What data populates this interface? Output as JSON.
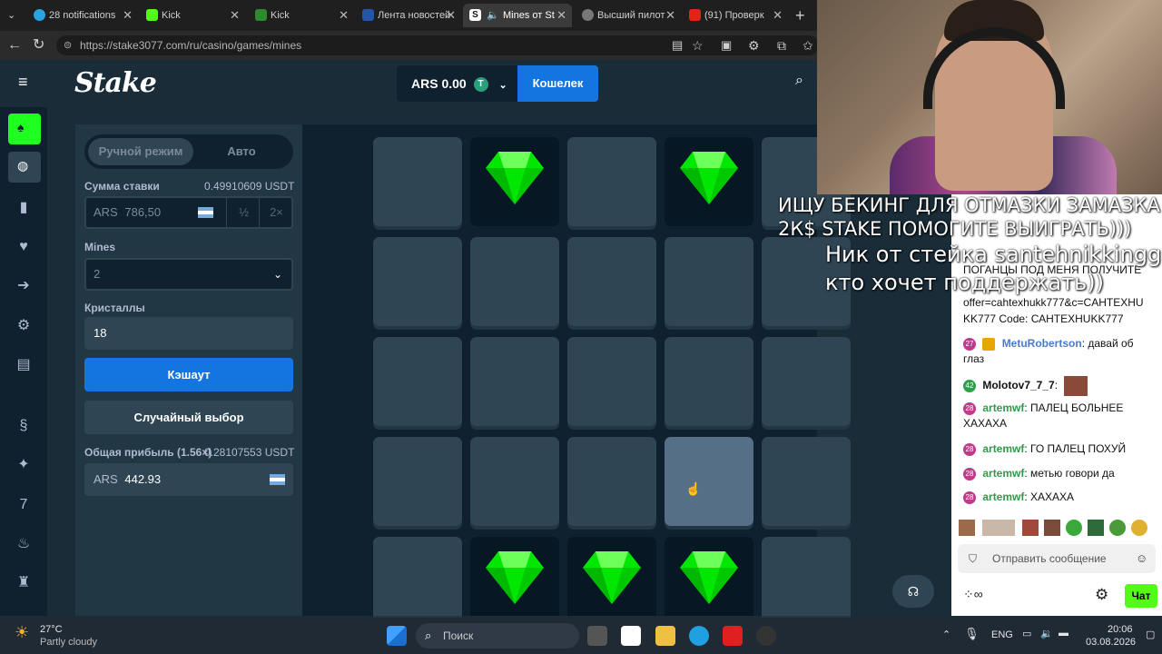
{
  "browser": {
    "tabs": [
      {
        "title": "28 notifications"
      },
      {
        "title": "Kick"
      },
      {
        "title": "Kick"
      },
      {
        "title": "Лента новостей"
      },
      {
        "title": "Mines от St"
      },
      {
        "title": "Высший пилот"
      },
      {
        "title": "(91) Проверк"
      }
    ],
    "url": "https://stake3077.com/ru/casino/games/mines"
  },
  "stake": {
    "logo": "Stake",
    "balance": "ARS 0.00",
    "currency_icon": "T",
    "wallet_label": "Кошелек"
  },
  "controls": {
    "mode_manual": "Ручной режим",
    "mode_auto": "Авто",
    "bet_label": "Сумма ставки",
    "bet_usdt": "0.49910609 USDT",
    "bet_currency": "ARS",
    "bet_value": "786,50",
    "half": "½",
    "double": "2×",
    "mines_label": "Mines",
    "mines_value": "2",
    "gems_label": "Кристаллы",
    "gems_value": "18",
    "cashout_label": "Кэшаут",
    "random_label": "Случайный выбор",
    "profit_label": "Общая прибыль (1.56×)",
    "profit_usdt": "0.28107553 USDT",
    "profit_currency": "ARS",
    "profit_value": "442.93"
  },
  "board": {
    "gems_at": [
      [
        0,
        1
      ],
      [
        0,
        3
      ],
      [
        4,
        1
      ],
      [
        4,
        2
      ],
      [
        4,
        3
      ]
    ],
    "hover_tile": [
      3,
      3
    ]
  },
  "overlay": {
    "line1": "ИЩУ БЕКИНГ ДЛЯ ОТМАЗКИ ЗАМАЗКА",
    "line2": "2К$ STAKE ПОМОГИТЕ ВЫИГРАТЬ)))",
    "line3": "Ник от стейка santehnikkingg",
    "line4": "кто хочет поддержать))"
  },
  "chat": {
    "messages": [
      {
        "badge": "",
        "user": "",
        "text": "ПОГАНЦЫ ПОД МЕНЯ ПОЛУЧИТЕ"
      },
      {
        "badge": "",
        "user": "",
        "text": "offer=cahtexhukk777&c=CAHTEXHU"
      },
      {
        "badge": "",
        "user": "",
        "text": "KK777 Code: САНТЕХНUKK777"
      },
      {
        "badge": "27",
        "user": "MetuRobertson",
        "text": ": давай об глаз"
      },
      {
        "badge": "42",
        "user": "Molotov7_7_7",
        "text": ":"
      },
      {
        "badge": "28",
        "user": "artemwf",
        "text": ": ПАЛЕЦ БОЛЬНЕЕ ХАХАХА"
      },
      {
        "badge": "28",
        "user": "artemwf",
        "text": ": ГО ПАЛЕЦ ПОХУЙ"
      },
      {
        "badge": "28",
        "user": "artemwf",
        "text": ": метью говори да"
      },
      {
        "badge": "28",
        "user": "artemwf",
        "text": ": ХАХАХА"
      }
    ],
    "input_placeholder": "Отправить сообщение",
    "send_label": "Чат"
  },
  "taskbar": {
    "temp": "27°C",
    "weather": "Partly cloudy",
    "search": "Поиск",
    "lang": "ENG",
    "time": "20:06",
    "date": "03.08.2026"
  },
  "colors": {
    "accent_blue": "#1475e1",
    "board_bg": "#0f212e",
    "tile": "#2f4553",
    "gem": "#00e701",
    "kick_green": "#53fc18"
  }
}
